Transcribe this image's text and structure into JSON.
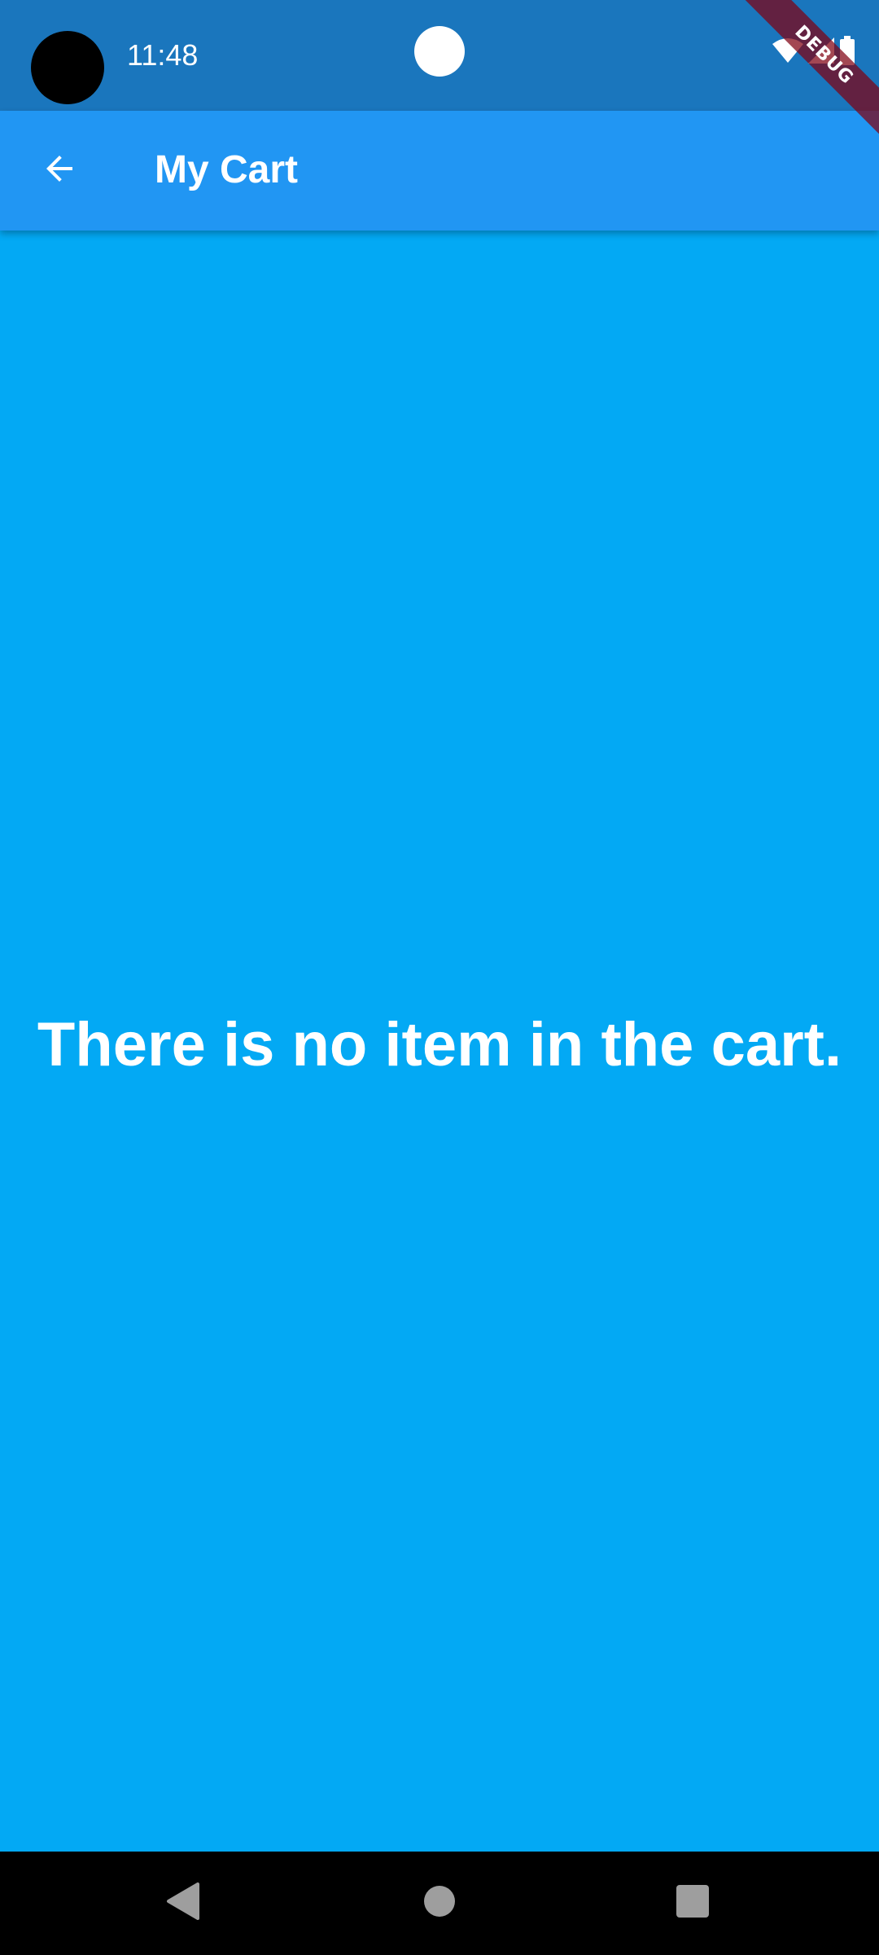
{
  "status_bar": {
    "time": "11:48",
    "icons": [
      "wifi-icon",
      "cellular-signal-icon",
      "battery-icon"
    ]
  },
  "debug_banner": {
    "label": "DEBUG"
  },
  "app_bar": {
    "title": "My Cart",
    "back_icon": "arrow-back-icon"
  },
  "content": {
    "empty_message": "There is no item in the cart."
  },
  "nav_bar": {
    "icons": [
      "nav-back-icon",
      "nav-home-icon",
      "nav-recents-icon"
    ]
  },
  "colors": {
    "status_bar": "#1A76BD",
    "app_bar": "#2196F3",
    "background": "#03A9F4",
    "text": "#FFFFFF",
    "nav_bar": "#000000",
    "debug_banner": "#800010"
  }
}
